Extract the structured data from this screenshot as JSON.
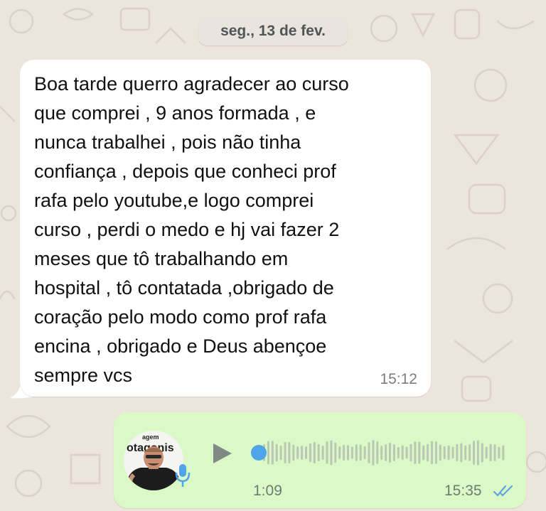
{
  "date_separator": "seg., 13 de fev.",
  "incoming_message": {
    "text": "Boa tarde querro agradecer ao curso\nque comprei , 9 anos formada , e\nnunca trabalhei , pois não tinha\nconfiança , depois que conheci prof\nrafa pelo youtube,e logo comprei\ncurso , perdi o medo e hj vai fazer 2\nmeses que tô trabalhando em\nhospital , tô contatada ,obrigado de\ncoração pelo modo como prof rafa\nencina , obrigado e Deus abençoe\nsempre vcs",
    "time": "15:12"
  },
  "voice_message": {
    "avatar_text_line1": "agem",
    "avatar_text_line2": "otagonis",
    "duration": "1:09",
    "time": "15:35",
    "progress": 0,
    "status": "read",
    "icons": [
      "play-icon",
      "microphone-icon",
      "double-check-icon"
    ]
  },
  "colors": {
    "wallpaper": "#ece5dc",
    "incoming_bubble": "#ffffff",
    "outgoing_bubble": "#dbf8c7",
    "accent_blue": "#4fa5e8",
    "read_ticks": "#5fa5e0"
  }
}
